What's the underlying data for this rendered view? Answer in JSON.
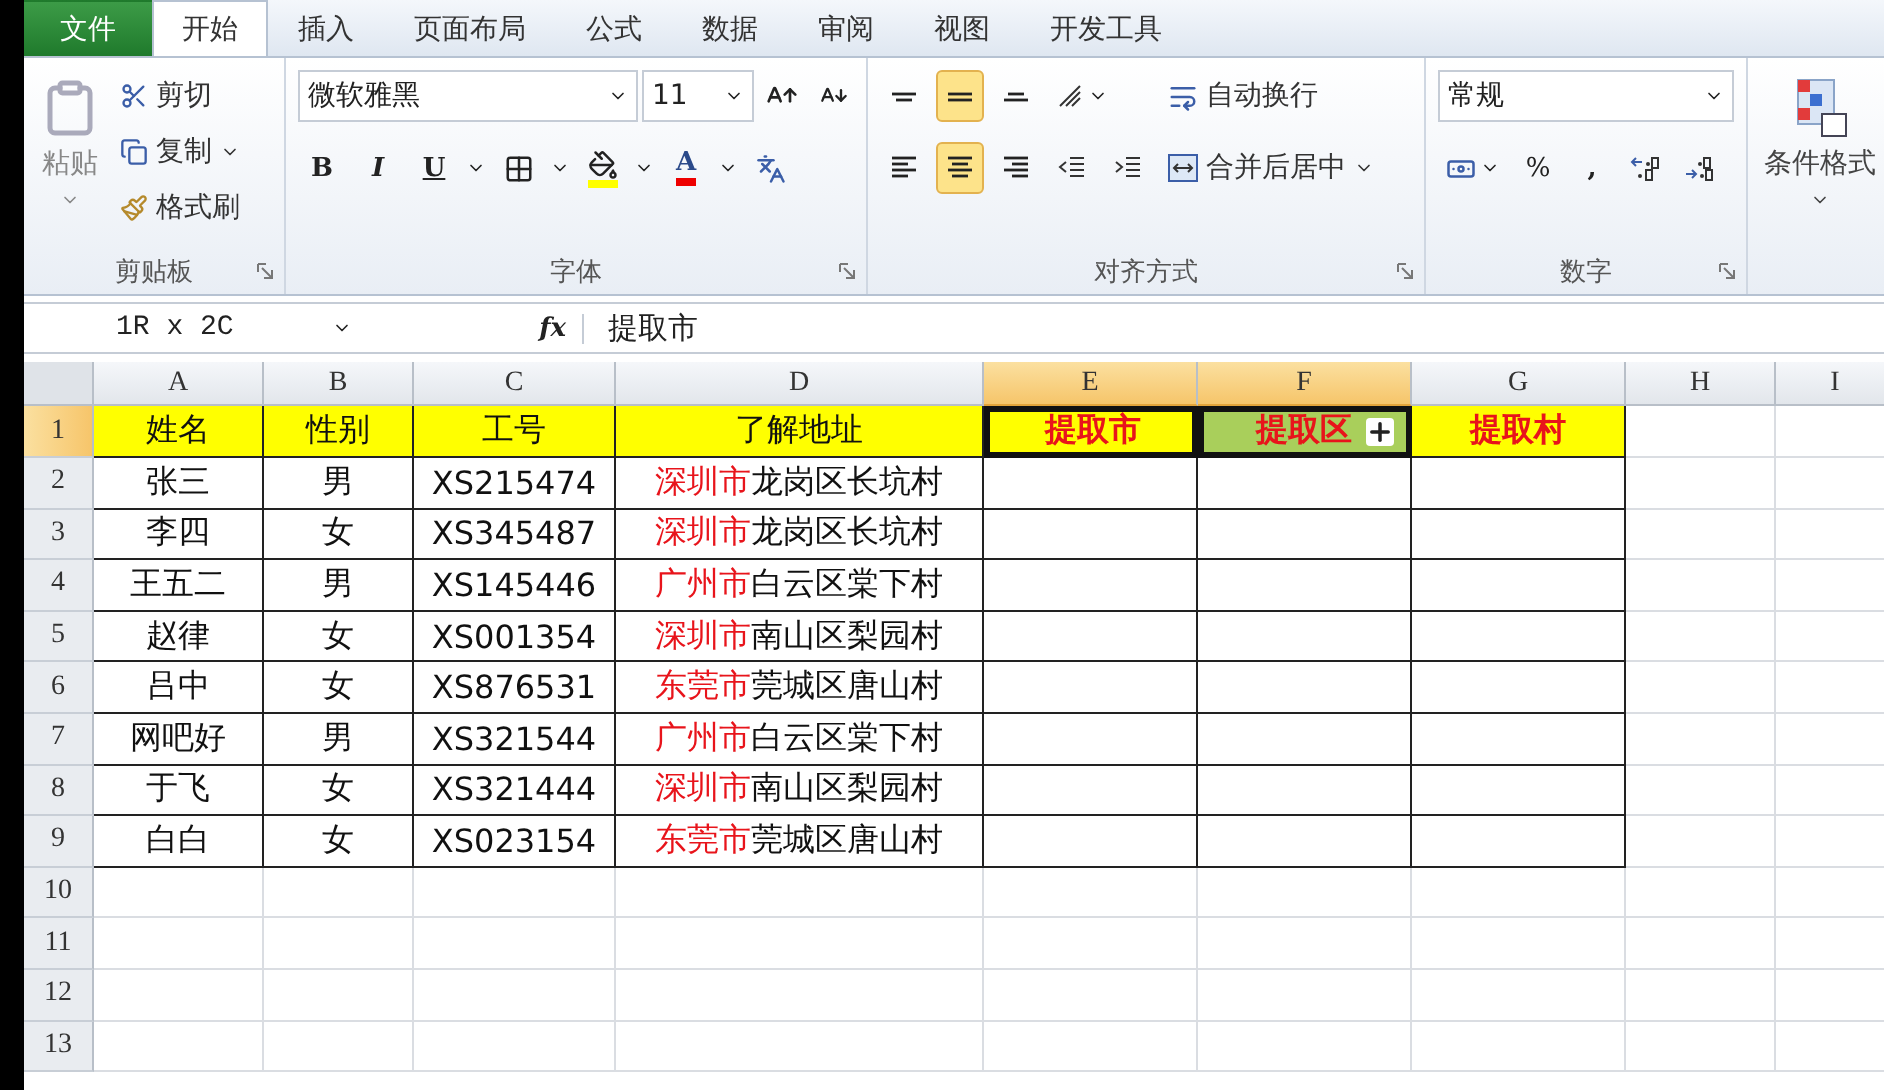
{
  "tabs": [
    {
      "label": "文件",
      "kind": "file",
      "selected": false
    },
    {
      "label": "开始",
      "kind": "tab",
      "selected": true
    },
    {
      "label": "插入",
      "kind": "tab",
      "selected": false
    },
    {
      "label": "页面布局",
      "kind": "tab",
      "selected": false
    },
    {
      "label": "公式",
      "kind": "tab",
      "selected": false
    },
    {
      "label": "数据",
      "kind": "tab",
      "selected": false
    },
    {
      "label": "审阅",
      "kind": "tab",
      "selected": false
    },
    {
      "label": "视图",
      "kind": "tab",
      "selected": false
    },
    {
      "label": "开发工具",
      "kind": "tab",
      "selected": false
    }
  ],
  "ribbon": {
    "clipboard": {
      "title": "剪贴板",
      "paste": "粘贴",
      "cut": "剪切",
      "copy": "复制",
      "format_painter": "格式刷"
    },
    "font": {
      "title": "字体",
      "font_name": "微软雅黑",
      "font_size": "11",
      "bold": "B",
      "italic": "I",
      "underline": "U",
      "font_color": "A"
    },
    "alignment": {
      "title": "对齐方式",
      "vertical": [
        {
          "kind": "top",
          "selected": false
        },
        {
          "kind": "middle",
          "selected": true
        },
        {
          "kind": "bottom",
          "selected": false
        }
      ],
      "horizontal": [
        {
          "kind": "left",
          "selected": false
        },
        {
          "kind": "center",
          "selected": true
        },
        {
          "kind": "right",
          "selected": false
        }
      ],
      "wrap_text": "自动换行",
      "merge_center": "合并后居中"
    },
    "number": {
      "title": "数字",
      "format": "常规",
      "percent": "%",
      "comma": ","
    },
    "styles": {
      "conditional_format": "条件格式"
    }
  },
  "formula_bar": {
    "name_box": "1R x 2C",
    "fx": "fx",
    "formula": "提取市"
  },
  "sheet": {
    "columns": [
      {
        "label": "A",
        "selected": false
      },
      {
        "label": "B",
        "selected": false
      },
      {
        "label": "C",
        "selected": false
      },
      {
        "label": "D",
        "selected": false
      },
      {
        "label": "E",
        "selected": true
      },
      {
        "label": "F",
        "selected": true
      },
      {
        "label": "G",
        "selected": false
      },
      {
        "label": "H",
        "selected": false
      },
      {
        "label": "I",
        "selected": false
      }
    ],
    "header_row": {
      "label": "1",
      "selected": true,
      "cells": [
        {
          "text": "姓名",
          "kind": "label",
          "selected": false,
          "active": false
        },
        {
          "text": "性别",
          "kind": "label",
          "selected": false,
          "active": false
        },
        {
          "text": "工号",
          "kind": "label",
          "selected": false,
          "active": false
        },
        {
          "text": "了解地址",
          "kind": "label",
          "selected": false,
          "active": false
        },
        {
          "text": "提取市",
          "kind": "target",
          "selected": true,
          "active": true
        },
        {
          "text": "提取区",
          "kind": "target",
          "selected": true,
          "active": false
        },
        {
          "text": "提取村",
          "kind": "target",
          "selected": false,
          "active": false
        }
      ]
    },
    "rows": [
      {
        "label": "2",
        "name": "张三",
        "gender": "男",
        "id": "XS215474",
        "city": "深圳市",
        "rest": "龙岗区长坑村"
      },
      {
        "label": "3",
        "name": "李四",
        "gender": "女",
        "id": "XS345487",
        "city": "深圳市",
        "rest": "龙岗区长坑村"
      },
      {
        "label": "4",
        "name": "王五二",
        "gender": "男",
        "id": "XS145446",
        "city": "广州市",
        "rest": "白云区棠下村"
      },
      {
        "label": "5",
        "name": "赵律",
        "gender": "女",
        "id": "XS001354",
        "city": "深圳市",
        "rest": "南山区梨园村"
      },
      {
        "label": "6",
        "name": "吕中",
        "gender": "女",
        "id": "XS876531",
        "city": "东莞市",
        "rest": "莞城区唐山村"
      },
      {
        "label": "7",
        "name": "网吧好",
        "gender": "男",
        "id": "XS321544",
        "city": "广州市",
        "rest": "白云区棠下村"
      },
      {
        "label": "8",
        "name": "于飞",
        "gender": "女",
        "id": "XS321444",
        "city": "深圳市",
        "rest": "南山区梨园村"
      },
      {
        "label": "9",
        "name": "白白",
        "gender": "女",
        "id": "XS023154",
        "city": "东莞市",
        "rest": "莞城区唐山村"
      }
    ],
    "empty_rows": [
      "10",
      "11",
      "12",
      "13"
    ]
  }
}
